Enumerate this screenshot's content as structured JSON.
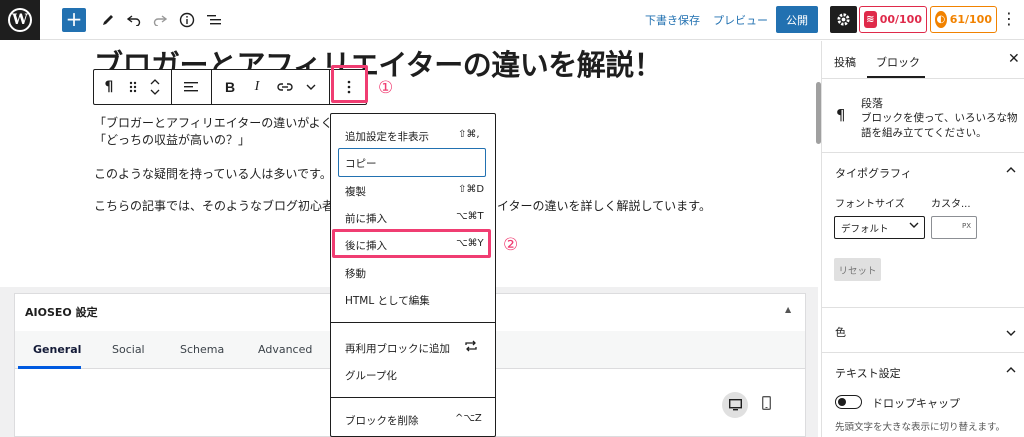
{
  "topbar": {
    "wp_logo": "W",
    "add_icon": "+",
    "tool_icons": [
      "pencil-icon",
      "undo-icon",
      "redo-icon",
      "info-icon",
      "list-view-icon"
    ],
    "save_draft": "下書き保存",
    "preview": "プレビュー",
    "publish": "公開",
    "score_red": "00/100",
    "score_orange": "61/100",
    "more": "⋮"
  },
  "editor": {
    "title": "ブロガーとアフィリエイターの違いを解説！",
    "block_toolbar": {
      "paragraph_icon": "¶",
      "bold": "B",
      "italic": "I"
    },
    "callouts": [
      "①",
      "②"
    ],
    "paragraphs": [
      "「ブロガーとアフィリエイターの違いがよく",
      "「どっちの収益が高いの？」",
      "このような疑問を持っている人は多いです。",
      "こちらの記事では、そのようなブログ初心者",
      "イターの違いを詳しく解説しています。"
    ]
  },
  "dropdown": {
    "items": [
      {
        "label": "追加設定を非表示",
        "shortcut": "⇧⌘,"
      },
      {
        "label": "コピー",
        "shortcut": ""
      },
      {
        "label": "複製",
        "shortcut": "⇧⌘D"
      },
      {
        "label": "前に挿入",
        "shortcut": "⌥⌘T"
      },
      {
        "label": "後に挿入",
        "shortcut": "⌥⌘Y"
      },
      {
        "label": "移動",
        "shortcut": ""
      },
      {
        "label": "HTML として編集",
        "shortcut": ""
      },
      {
        "label": "再利用ブロックに追加",
        "shortcut": ""
      },
      {
        "label": "グループ化",
        "shortcut": ""
      },
      {
        "label": "ブロックを削除",
        "shortcut": "^⌥Z"
      }
    ]
  },
  "aioseo": {
    "title": "AIOSEO 設定",
    "tabs": [
      "General",
      "Social",
      "Schema",
      "Advanced"
    ],
    "active_tab": "General"
  },
  "sidebar": {
    "tabs": [
      "投稿",
      "ブロック"
    ],
    "active_tab": "ブロック",
    "block_name": "段落",
    "block_desc": "ブロックを使って、いろいろな物語を組み立ててください。",
    "typography": "タイポグラフィ",
    "font_size_label": "フォントサイズ",
    "custom_label": "カスタ...",
    "font_size_value": "デフォルト",
    "custom_unit": "PX",
    "reset": "リセット",
    "color": "色",
    "text_settings": "テキスト設定",
    "drop_cap": "ドロップキャップ",
    "drop_cap_help": "先頭文字を大きな表示に切り替えます。"
  },
  "colors": {
    "accent": "#2271b1",
    "highlight": "#f03d72",
    "score_red": "#df2a4a",
    "score_orange": "#f18200"
  }
}
